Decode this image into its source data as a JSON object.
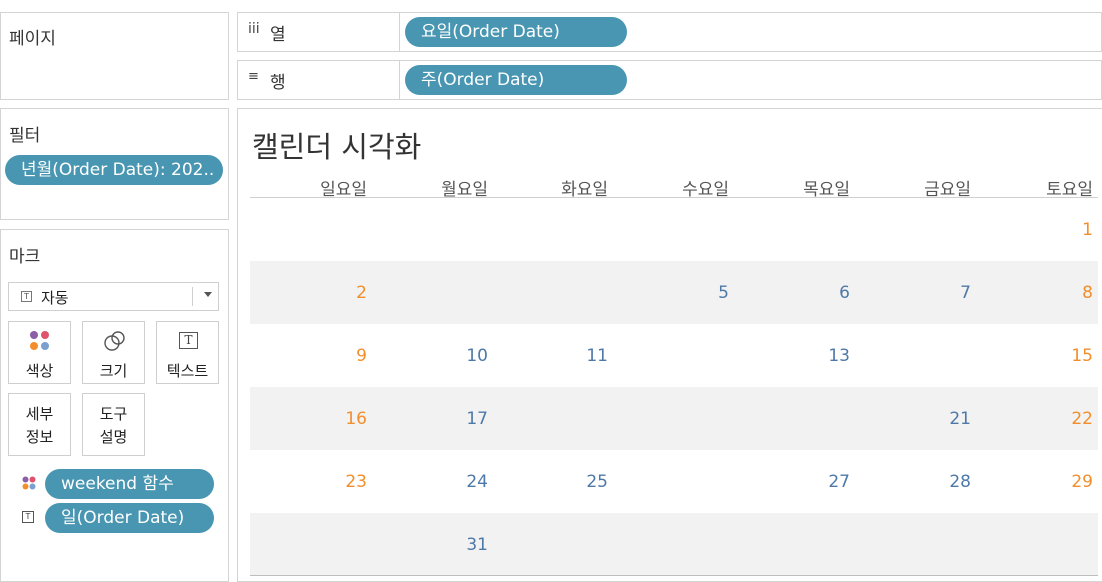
{
  "left": {
    "pages_title": "페이지",
    "filters_title": "필터",
    "filter_pill": "년월(Order Date): 202..",
    "marks_title": "마크",
    "mark_type": "자동",
    "mark_buttons": {
      "color": "색상",
      "size": "크기",
      "text": "텍스트",
      "detail_line1": "세부",
      "detail_line2": "정보",
      "tooltip_line1": "도구",
      "tooltip_line2": "설명"
    },
    "mark_fields": [
      "weekend 함수",
      "일(Order Date)"
    ]
  },
  "shelves": {
    "columns_label": "열",
    "columns_pill": "요일(Order Date)",
    "rows_label": "행",
    "rows_pill": "주(Order Date)"
  },
  "view": {
    "title": "캘린더 시각화",
    "weekday_headers": [
      "일요일",
      "월요일",
      "화요일",
      "수요일",
      "목요일",
      "금요일",
      "토요일"
    ],
    "weeks": [
      [
        "",
        "",
        "",
        "",
        "",
        "",
        "1"
      ],
      [
        "2",
        "",
        "",
        "5",
        "6",
        "7",
        "8"
      ],
      [
        "9",
        "10",
        "11",
        "",
        "13",
        "",
        "15"
      ],
      [
        "16",
        "17",
        "",
        "",
        "",
        "21",
        "22"
      ],
      [
        "23",
        "24",
        "25",
        "",
        "27",
        "28",
        "29"
      ],
      [
        "",
        "31",
        "",
        "",
        "",
        "",
        ""
      ]
    ]
  },
  "colors": {
    "weekend": "#f28e2b",
    "weekday": "#4e79a7",
    "pill": "#4996b2"
  }
}
